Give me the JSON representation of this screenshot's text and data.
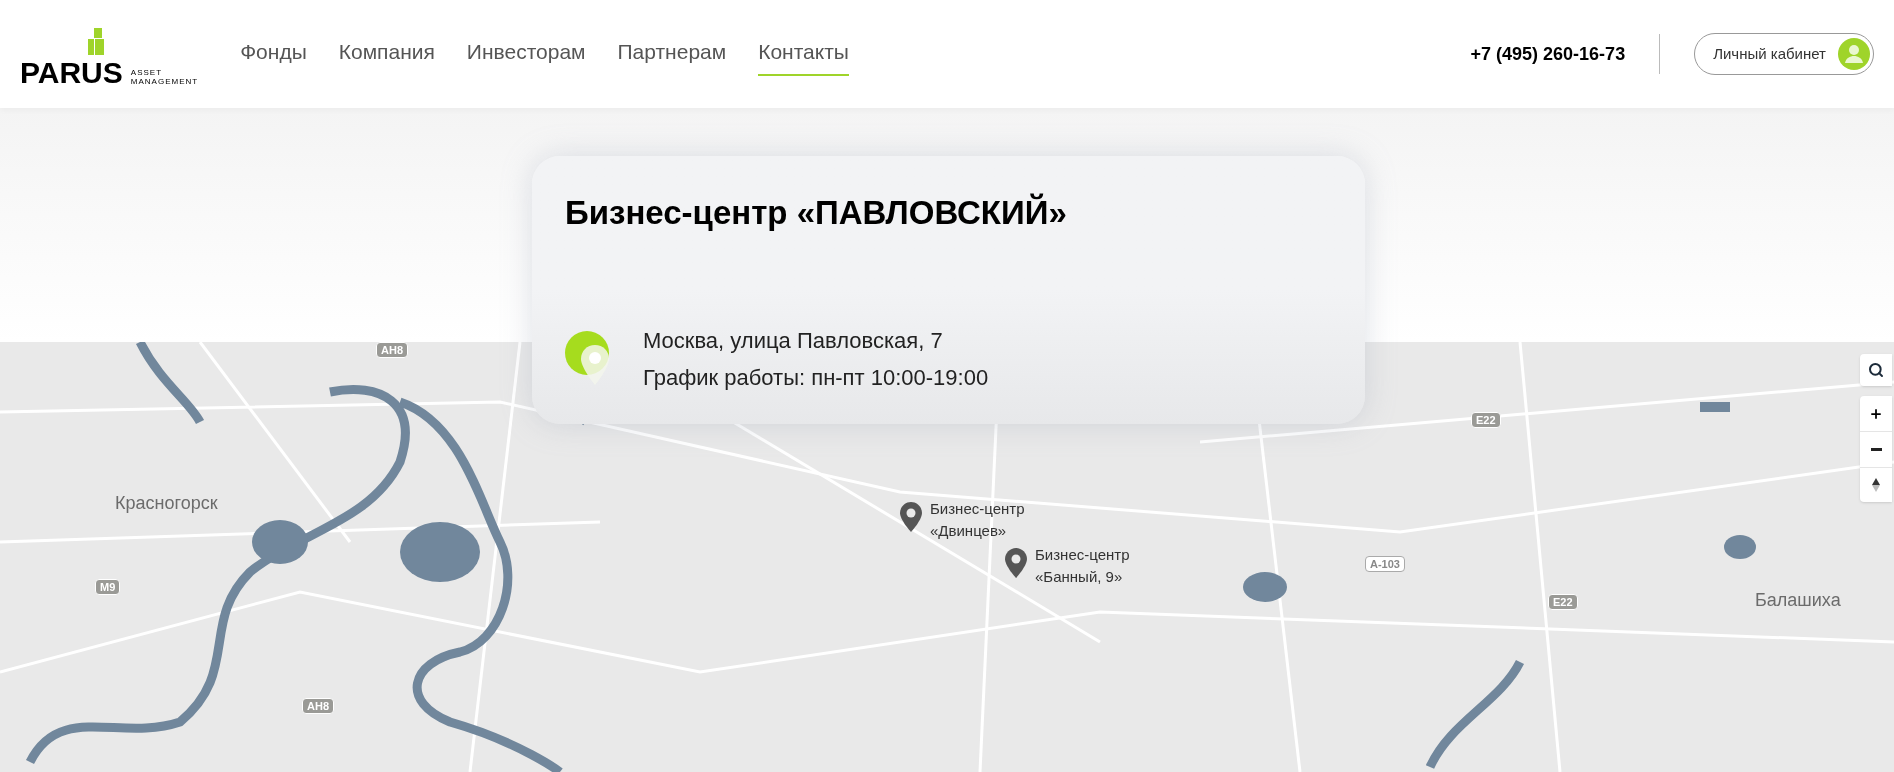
{
  "header": {
    "logo": {
      "wordmark": "PARUS",
      "tagline_1": "ASSET",
      "tagline_2": "MANAGEMENT"
    },
    "nav": [
      {
        "label": "Фонды",
        "selected": false
      },
      {
        "label": "Компания",
        "selected": false
      },
      {
        "label": "Инвесторам",
        "selected": false
      },
      {
        "label": "Партнерам",
        "selected": false
      },
      {
        "label": "Контакты",
        "selected": true
      }
    ],
    "phone": "+7 (495) 260-16-73",
    "account_button": "Личный кабинет"
  },
  "office_card": {
    "title": "Бизнес-центр «ПАВЛОВСКИЙ»",
    "address": "Москва, улица Павловская, 7",
    "hours": "График работы: пн-пт 10:00-19:00"
  },
  "map": {
    "places": [
      {
        "kind": "city",
        "label": "Красногорск"
      },
      {
        "kind": "city",
        "label": "Балашиха"
      },
      {
        "kind": "road",
        "label": "АН8"
      },
      {
        "kind": "road",
        "label": "АН8"
      },
      {
        "kind": "road",
        "label": "М9"
      },
      {
        "kind": "road",
        "label": "Е22"
      },
      {
        "kind": "road",
        "label": "Е22"
      },
      {
        "kind": "road",
        "label": "А-103"
      },
      {
        "kind": "office",
        "label": "Бизнес-центр «Двинцев»"
      },
      {
        "kind": "office",
        "label": "Бизнес-центр «Банный, 9»"
      }
    ]
  }
}
